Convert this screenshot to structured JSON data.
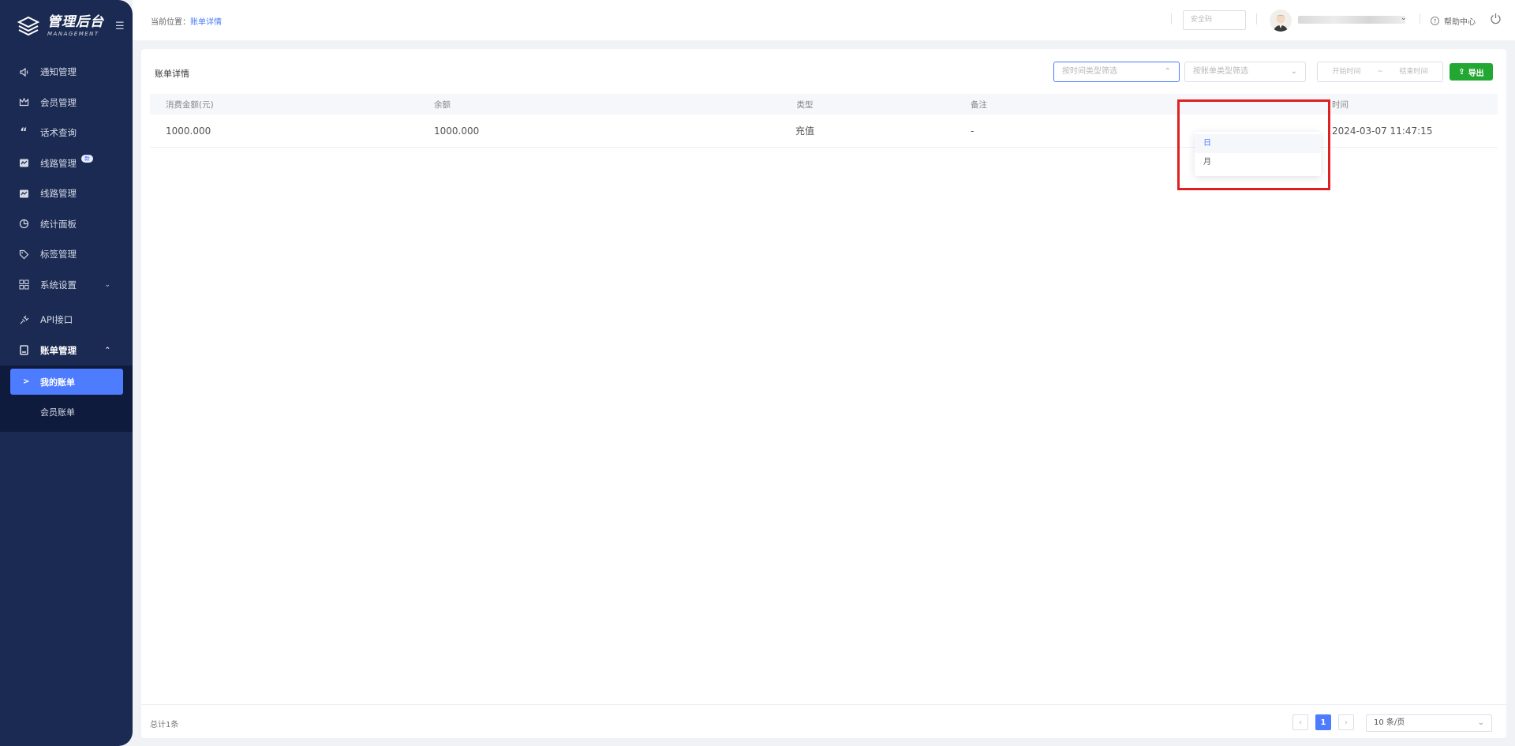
{
  "app": {
    "title": "管理后台",
    "subtitle": "MANAGEMENT"
  },
  "sidebar": {
    "items": [
      {
        "label": "通知管理",
        "icon": "speaker-icon"
      },
      {
        "label": "会员管理",
        "icon": "crown-icon"
      },
      {
        "label": "话术查询",
        "icon": "quote-icon"
      },
      {
        "label": "线路管理",
        "icon": "route-icon",
        "badge": "新"
      },
      {
        "label": "线路管理",
        "icon": "route-icon"
      },
      {
        "label": "统计面板",
        "icon": "pie-chart-icon"
      },
      {
        "label": "标签管理",
        "icon": "tag-icon"
      },
      {
        "label": "系统设置",
        "icon": "grid-icon"
      },
      {
        "label": "API接口",
        "icon": "plug-icon"
      },
      {
        "label": "账单管理",
        "icon": "book-icon"
      }
    ],
    "submenu": [
      {
        "label": "我的账单"
      },
      {
        "label": "会员账单"
      }
    ]
  },
  "header": {
    "breadcrumb_prefix": "当前位置：",
    "breadcrumb_current": "账单详情",
    "security_code_placeholder": "安全码",
    "help_label": "帮助中心"
  },
  "main": {
    "title": "账单详情",
    "filters": {
      "time_type_placeholder": "按时间类型筛选",
      "bill_type_placeholder": "按账单类型筛选",
      "start_placeholder": "开始时间",
      "range_sep": "~",
      "end_placeholder": "结束时间"
    },
    "export_label": "导出",
    "dropdown_options": [
      "日",
      "月"
    ],
    "table": {
      "columns": [
        "消费金额(元)",
        "余额",
        "类型",
        "备注",
        "时间"
      ],
      "rows": [
        [
          "1000.000",
          "1000.000",
          "充值",
          "-",
          "2024-03-07 11:47:15"
        ]
      ]
    },
    "footer": {
      "total": "总计1条",
      "current_page": "1",
      "page_size": "10 条/页"
    }
  },
  "colors": {
    "sidebar": "#1b2a52",
    "accent": "#4d7cfe",
    "export": "#22a832",
    "highlight": "#e02020"
  }
}
